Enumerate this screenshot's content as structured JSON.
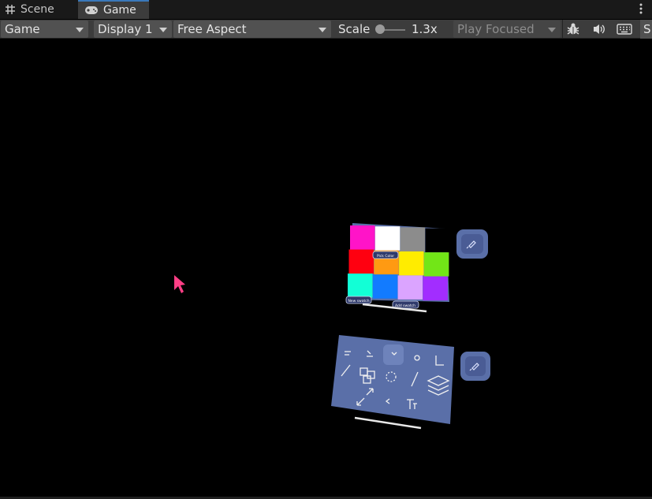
{
  "tabs": [
    {
      "label": "Scene",
      "icon": "grid-icon"
    },
    {
      "label": "Game",
      "icon": "gamepad-icon"
    }
  ],
  "toolbar": {
    "view_mode": "Game",
    "display": "Display 1",
    "aspect": "Free Aspect",
    "scale_label": "Scale",
    "scale_value": "1.3x",
    "play_mode": "Play Focused",
    "stats_label": "S",
    "icons": [
      "bug-icon",
      "speaker-icon",
      "keyboard-icon"
    ]
  },
  "scene": {
    "color_panel": {
      "colors": [
        "#ff14c8",
        "#ffffff",
        "#8c8c8c",
        "#000000",
        "#ff0010",
        "#ff9a12",
        "#ffec00",
        "#72e617",
        "#12ffd6",
        "#127bff",
        "#dba4ff",
        "#a22dff"
      ],
      "center_button": "Pick Color",
      "left_button": "New swatch",
      "right_button": "Add swatch"
    },
    "accent": "#5a6fa8",
    "cursor_color": "#ff3f86"
  }
}
